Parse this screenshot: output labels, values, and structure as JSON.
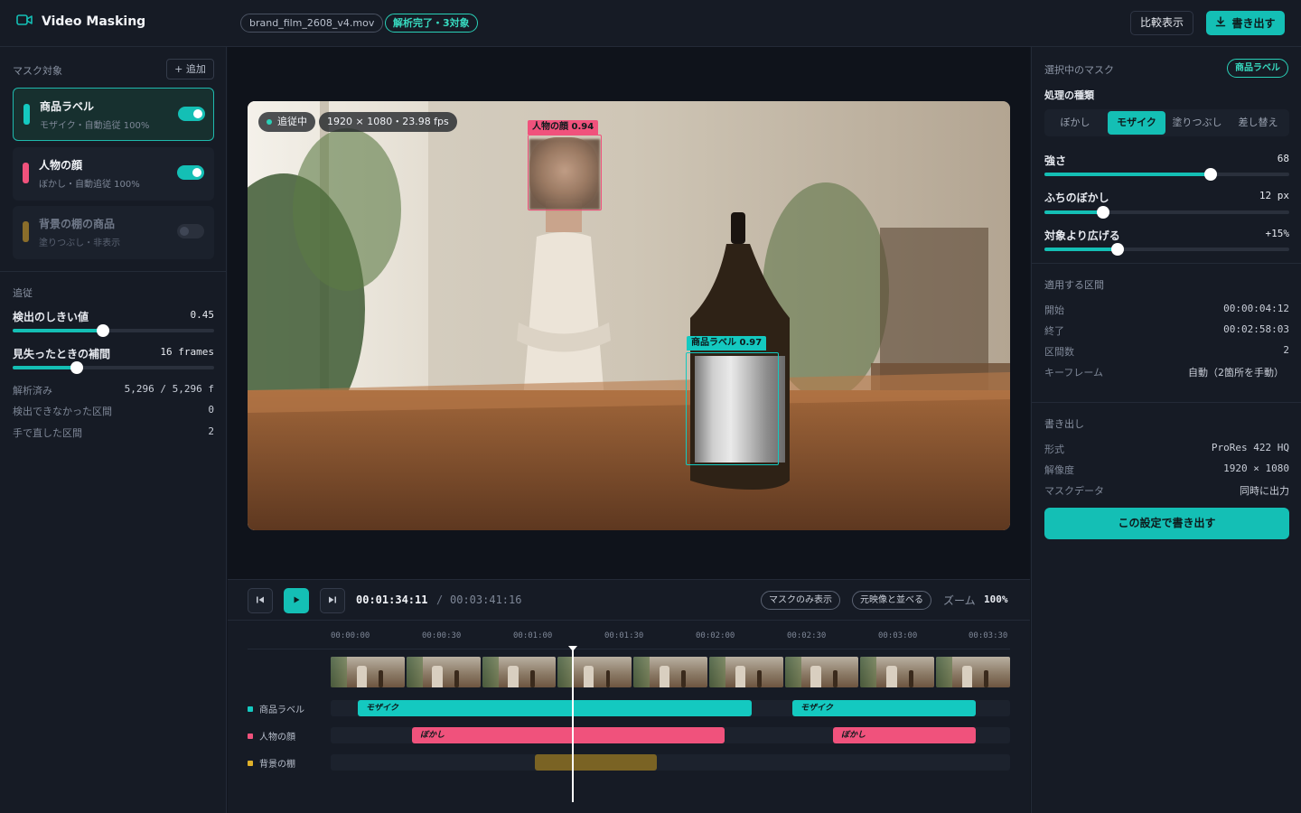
{
  "app": {
    "title": "Video Masking",
    "file_name": "brand_film_2608_v4.mov",
    "status": "解析完了・3対象"
  },
  "header": {
    "compare_label": "比較表示",
    "export_label": "書き出す"
  },
  "left": {
    "section_title": "マスク対象",
    "add_label": "+ 追加",
    "masks": [
      {
        "name": "商品ラベル",
        "sub": "モザイク・自動追従 100%",
        "color": "#14c9c0",
        "on": true
      },
      {
        "name": "人物の顔",
        "sub": "ぼかし・自動追従 100%",
        "color": "#f0527c",
        "on": true
      },
      {
        "name": "背景の棚の商品",
        "sub": "塗りつぶし・非表示",
        "color": "#8a6d2a",
        "on": false
      }
    ],
    "tracking_title": "追従",
    "threshold": {
      "label": "検出のしきい値",
      "value": "0.45",
      "level": 0.45
    },
    "interp": {
      "label": "見失ったときの補間",
      "value": "16 frames",
      "level": 0.32
    },
    "stats": [
      {
        "label": "解析済み",
        "value": "5,296 / 5,296 f"
      },
      {
        "label": "検出できなかった区間",
        "value": "0"
      },
      {
        "label": "手で直した区間",
        "value": "2"
      }
    ]
  },
  "video": {
    "chip_tracking": "追従中",
    "chip_info": "1920 × 1080・23.98 fps",
    "det_face": "人物の顔 0.94",
    "det_label": "商品ラベル 0.97"
  },
  "controls": {
    "current_tc": "00:01:34:11",
    "separator": "/",
    "total_tc": "00:03:41:16",
    "mask_only": "マスクのみ表示",
    "side_by_side": "元映像と並べる",
    "zoom_label": "ズーム",
    "zoom_value": "100%"
  },
  "timeline": {
    "ruler": [
      "00:00:00",
      "00:00:30",
      "00:01:00",
      "00:01:30",
      "00:02:00",
      "00:02:30",
      "00:03:00",
      "00:03:30"
    ],
    "tracks": [
      {
        "name": "商品ラベル",
        "clips": [
          "モザイク",
          "モザイク"
        ]
      },
      {
        "name": "人物の顔",
        "clips": [
          "ぼかし",
          "ぼかし"
        ]
      },
      {
        "name": "背景の棚",
        "clips": [
          ""
        ]
      }
    ]
  },
  "right": {
    "section_title": "選択中のマスク",
    "badge": "商品ラベル",
    "type_title": "処理の種類",
    "types": [
      "ぼかし",
      "モザイク",
      "塗りつぶし",
      "差し替え"
    ],
    "active_type": "モザイク",
    "strength": {
      "label": "強さ",
      "value": "68",
      "level": 0.68
    },
    "feather": {
      "label": "ふちのぼかし",
      "value": "12 px",
      "level": 0.24
    },
    "expand": {
      "label": "対象より広げる",
      "value": "+15%",
      "level": 0.3
    },
    "range_title": "適用する区間",
    "range": [
      {
        "label": "開始",
        "value": "00:00:04:12"
      },
      {
        "label": "終了",
        "value": "00:02:58:03"
      },
      {
        "label": "区間数",
        "value": "2"
      },
      {
        "label": "キーフレーム",
        "value": "自動（2箇所を手動）"
      }
    ],
    "export_title": "書き出し",
    "export": [
      {
        "label": "形式",
        "value": "ProRes 422 HQ"
      },
      {
        "label": "解像度",
        "value": "1920 × 1080"
      },
      {
        "label": "マスクデータ",
        "value": "同時に出力"
      }
    ],
    "cta": "この設定で書き出す"
  },
  "icons": [
    "video-camera-icon",
    "download-icon",
    "skip-back-icon",
    "play-icon",
    "skip-forward-icon"
  ],
  "colors": {
    "accent": "#14bfb5",
    "face": "#f0527c",
    "shelf": "#8a6d2a"
  }
}
